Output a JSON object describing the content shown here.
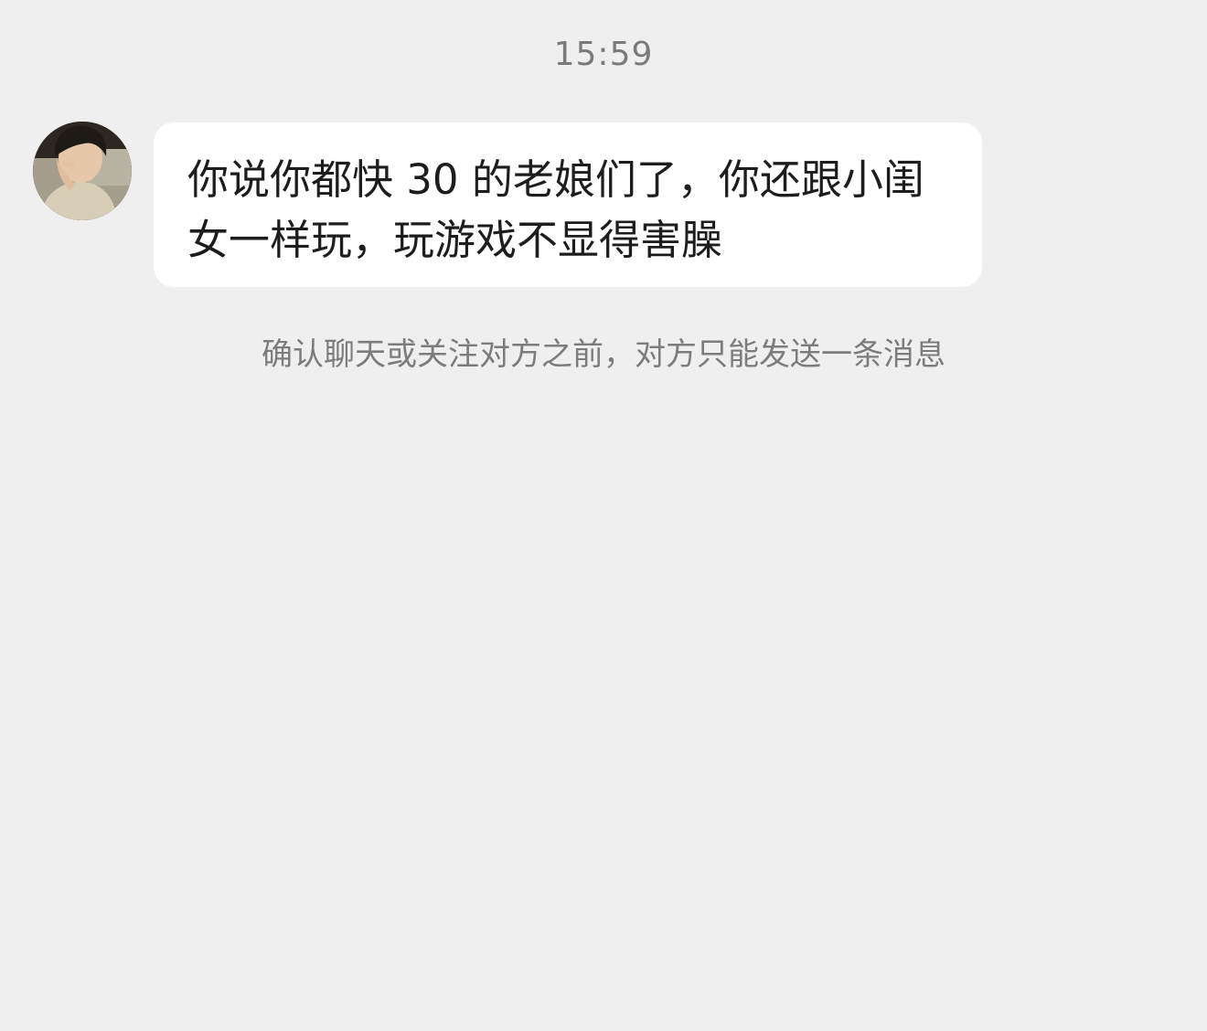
{
  "chat": {
    "timestamp": "15:59",
    "messages": [
      {
        "sender": "other",
        "avatar_icon": "user-avatar-photo",
        "text": "你说你都快 30 的老娘们了，你还跟小闺女一样玩，玩游戏不显得害臊"
      }
    ],
    "notice": "确认聊天或关注对方之前，对方只能发送一条消息"
  },
  "colors": {
    "background": "#efefef",
    "bubble": "#ffffff",
    "text_primary": "#1d1d1d",
    "text_secondary": "#7a7a7a"
  }
}
